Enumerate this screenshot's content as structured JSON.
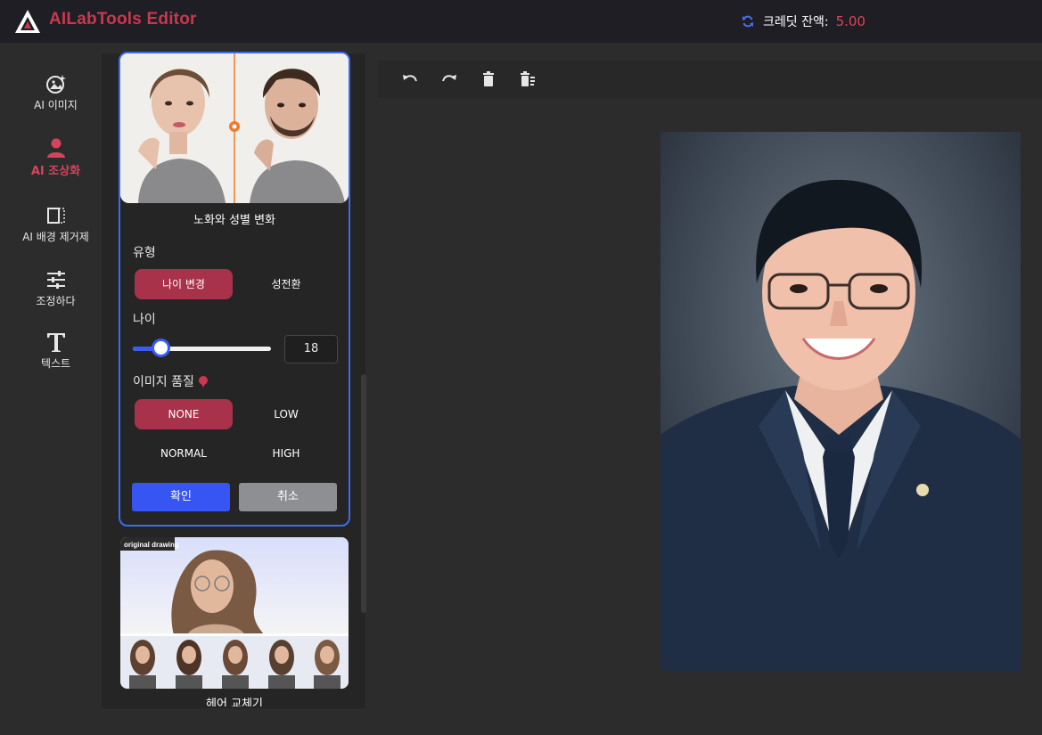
{
  "app": {
    "title": "AILabTools Editor"
  },
  "credits": {
    "label": "크레딧 잔액:",
    "value": "5.00"
  },
  "nav": {
    "items": [
      {
        "label": "AI 이미지",
        "icon": "ai-image-icon"
      },
      {
        "label": "AI 조상화",
        "icon": "portrait-user-icon",
        "active": true
      },
      {
        "label": "AI 배경 제거제",
        "icon": "background-remove-icon"
      },
      {
        "label": "조정하다",
        "icon": "sliders-icon"
      },
      {
        "label": "텍스트",
        "icon": "text-T-icon"
      }
    ]
  },
  "panel": {
    "card_title": "노화와 성별 변화",
    "type_label": "유형",
    "type_options": [
      "나이 변경",
      "성전환"
    ],
    "type_selected": "나이 변경",
    "age_label": "나이",
    "age_value": "18",
    "age_slider_fraction": 0.2,
    "quality_label": "이미지 품질",
    "quality_options": [
      "NONE",
      "LOW",
      "NORMAL",
      "HIGH"
    ],
    "quality_selected": "NONE",
    "confirm_label": "확인",
    "cancel_label": "취소",
    "next_card_badge": "original drawing",
    "next_card_title": "헤어 교체기"
  },
  "toolbar": {
    "icons": [
      "undo-icon",
      "redo-icon",
      "delete-icon",
      "clear-all-icon"
    ]
  },
  "colors": {
    "brand": "#c8384f",
    "accent_blue": "#3755f2",
    "selected_segment": "#a8324a"
  }
}
